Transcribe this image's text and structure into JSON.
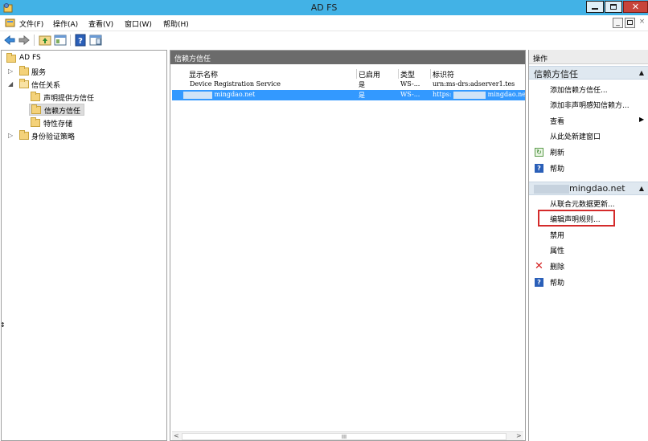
{
  "window": {
    "title": "AD FS",
    "app_icon": "adfs-app-icon",
    "close_glyph": "✕"
  },
  "menu": {
    "items": [
      "文件(F)",
      "操作(A)",
      "查看(V)",
      "窗口(W)",
      "帮助(H)"
    ],
    "mdi_minimize": "_",
    "mdi_restore": "🗗",
    "mdi_close": "×"
  },
  "toolbar": {
    "icons": [
      "back-arrow-icon",
      "forward-arrow-icon",
      "up-folder-icon",
      "show-hide-console-tree-icon",
      "help-icon",
      "show-hide-action-pane-icon"
    ]
  },
  "tree": {
    "root": "AD FS",
    "items": [
      {
        "label": "服务",
        "expanded": false
      },
      {
        "label": "信任关系",
        "expanded": true
      },
      {
        "label": "声明提供方信任"
      },
      {
        "label": "信赖方信任",
        "selected": true
      },
      {
        "label": "特性存储"
      },
      {
        "label": "身份验证策略",
        "expanded": false
      }
    ]
  },
  "center": {
    "header": "信赖方信任",
    "columns": [
      "显示名称",
      "已启用",
      "类型",
      "标识符"
    ],
    "rows": [
      {
        "name": "Device Registration Service",
        "enabled": "是",
        "type": "WS-...",
        "identifier": "urn:ms-drs:adserver1.tes",
        "selected": false
      },
      {
        "name": "mingdao.net",
        "enabled": "是",
        "type": "WS-...",
        "identifier_prefix": "https:",
        "identifier_suffix": "mingdao.ne",
        "selected": true
      }
    ],
    "scroll_grip": "III"
  },
  "actions": {
    "title": "操作",
    "group1": {
      "title": "信赖方信任",
      "items": [
        "添加信赖方信任...",
        "添加非声明感知信赖方...",
        "查看",
        "从此处新建窗口",
        "刷新",
        "帮助"
      ]
    },
    "group2": {
      "title": "mingdao.net",
      "items": [
        "从联合元数据更新...",
        "编辑声明规则...",
        "禁用",
        "属性",
        "删除",
        "帮助"
      ]
    }
  },
  "colors": {
    "titlebar": "#42b2e6",
    "selection": "#3399ff",
    "highlight": "#d42b2b"
  }
}
